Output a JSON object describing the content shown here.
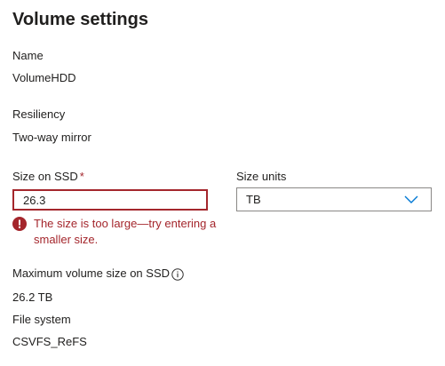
{
  "panel": {
    "title": "Volume settings"
  },
  "name": {
    "label": "Name",
    "value": "VolumeHDD"
  },
  "resiliency": {
    "label": "Resiliency",
    "value": "Two-way mirror"
  },
  "size_on_ssd": {
    "label": "Size on SSD",
    "required_marker": "*",
    "value": "26.3",
    "error": "The size is too large—try entering a smaller size."
  },
  "size_units": {
    "label": "Size units",
    "selected": "TB"
  },
  "max_volume_size": {
    "label": "Maximum volume size on SSD",
    "value": "26.2 TB",
    "icon": "info-icon"
  },
  "file_system": {
    "label": "File system",
    "value": "CSVFS_ReFS"
  },
  "colors": {
    "error": "#a4262c",
    "text": "#201f1e",
    "accent": "#0078d4",
    "border": "#8a8886"
  }
}
